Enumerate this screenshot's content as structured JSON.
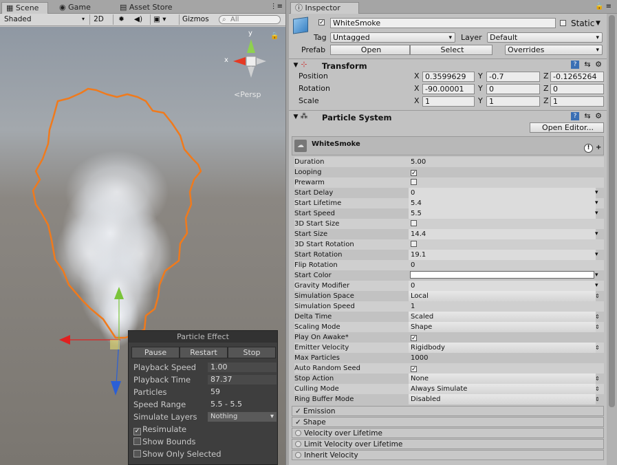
{
  "scene_window": {
    "tabs": [
      "Scene",
      "Game",
      "Asset Store"
    ],
    "shading": "Shaded",
    "mode_2d": "2D",
    "gizmos": "Gizmos",
    "search_placeholder": "All",
    "persp": "Persp",
    "axis_x": "x",
    "axis_y": "y"
  },
  "particle_effect": {
    "title": "Particle Effect",
    "buttons": [
      "Pause",
      "Restart",
      "Stop"
    ],
    "rows": [
      {
        "label": "Playback Speed",
        "value": "1.00"
      },
      {
        "label": "Playback Time",
        "value": "87.37"
      },
      {
        "label": "Particles",
        "value": "59"
      },
      {
        "label": "Speed Range",
        "value": "5.5 - 5.5"
      },
      {
        "label": "Simulate Layers",
        "value": "Nothing"
      }
    ],
    "checks": [
      {
        "label": "Resimulate",
        "checked": true
      },
      {
        "label": "Show Bounds",
        "checked": false
      },
      {
        "label": "Show Only Selected",
        "checked": false
      }
    ]
  },
  "inspector": {
    "tab": "Inspector",
    "object_name": "WhiteSmoke",
    "static_label": "Static",
    "tag_label": "Tag",
    "tag_value": "Untagged",
    "layer_label": "Layer",
    "layer_value": "Default",
    "prefab_label": "Prefab",
    "prefab_open": "Open",
    "prefab_select": "Select",
    "prefab_overrides": "Overrides",
    "transform": {
      "title": "Transform",
      "rows": [
        {
          "label": "Position",
          "x": "0.3599629",
          "y": "-0.7",
          "z": "-0.1265264"
        },
        {
          "label": "Rotation",
          "x": "-90.00001",
          "y": "0",
          "z": "0"
        },
        {
          "label": "Scale",
          "x": "1",
          "y": "1",
          "z": "1"
        }
      ]
    },
    "particle_system": {
      "title": "Particle System",
      "open_editor": "Open Editor...",
      "name": "WhiteSmoke",
      "props": [
        {
          "k": "Duration",
          "v": "5.00",
          "type": "num"
        },
        {
          "k": "Looping",
          "v": "✓",
          "type": "check"
        },
        {
          "k": "Prewarm",
          "v": "",
          "type": "check"
        },
        {
          "k": "Start Delay",
          "v": "0",
          "type": "curve"
        },
        {
          "k": "Start Lifetime",
          "v": "5.4",
          "type": "curve"
        },
        {
          "k": "Start Speed",
          "v": "5.5",
          "type": "curve"
        },
        {
          "k": "3D Start Size",
          "v": "",
          "type": "check"
        },
        {
          "k": "Start Size",
          "v": "14.4",
          "type": "curve"
        },
        {
          "k": "3D Start Rotation",
          "v": "",
          "type": "check"
        },
        {
          "k": "Start Rotation",
          "v": "19.1",
          "type": "curve"
        },
        {
          "k": "Flip Rotation",
          "v": "0",
          "type": "num"
        },
        {
          "k": "Start Color",
          "v": "",
          "type": "color"
        },
        {
          "k": "Gravity Modifier",
          "v": "0",
          "type": "curve"
        },
        {
          "k": "Simulation Space",
          "v": "Local",
          "type": "dd"
        },
        {
          "k": "Simulation Speed",
          "v": "1",
          "type": "num"
        },
        {
          "k": "Delta Time",
          "v": "Scaled",
          "type": "dd"
        },
        {
          "k": "Scaling Mode",
          "v": "Shape",
          "type": "dd"
        },
        {
          "k": "Play On Awake*",
          "v": "✓",
          "type": "check"
        },
        {
          "k": "Emitter Velocity",
          "v": "Rigidbody",
          "type": "dd"
        },
        {
          "k": "Max Particles",
          "v": "1000",
          "type": "num"
        },
        {
          "k": "Auto Random Seed",
          "v": "✓",
          "type": "check"
        },
        {
          "k": "Stop Action",
          "v": "None",
          "type": "dd"
        },
        {
          "k": "Culling Mode",
          "v": "Always Simulate",
          "type": "dd"
        },
        {
          "k": "Ring Buffer Mode",
          "v": "Disabled",
          "type": "dd"
        }
      ],
      "modules": [
        {
          "label": "Emission",
          "on": true
        },
        {
          "label": "Shape",
          "on": true
        },
        {
          "label": "Velocity over Lifetime",
          "on": false
        },
        {
          "label": "Limit Velocity over Lifetime",
          "on": false
        },
        {
          "label": "Inherit Velocity",
          "on": false
        }
      ]
    }
  }
}
